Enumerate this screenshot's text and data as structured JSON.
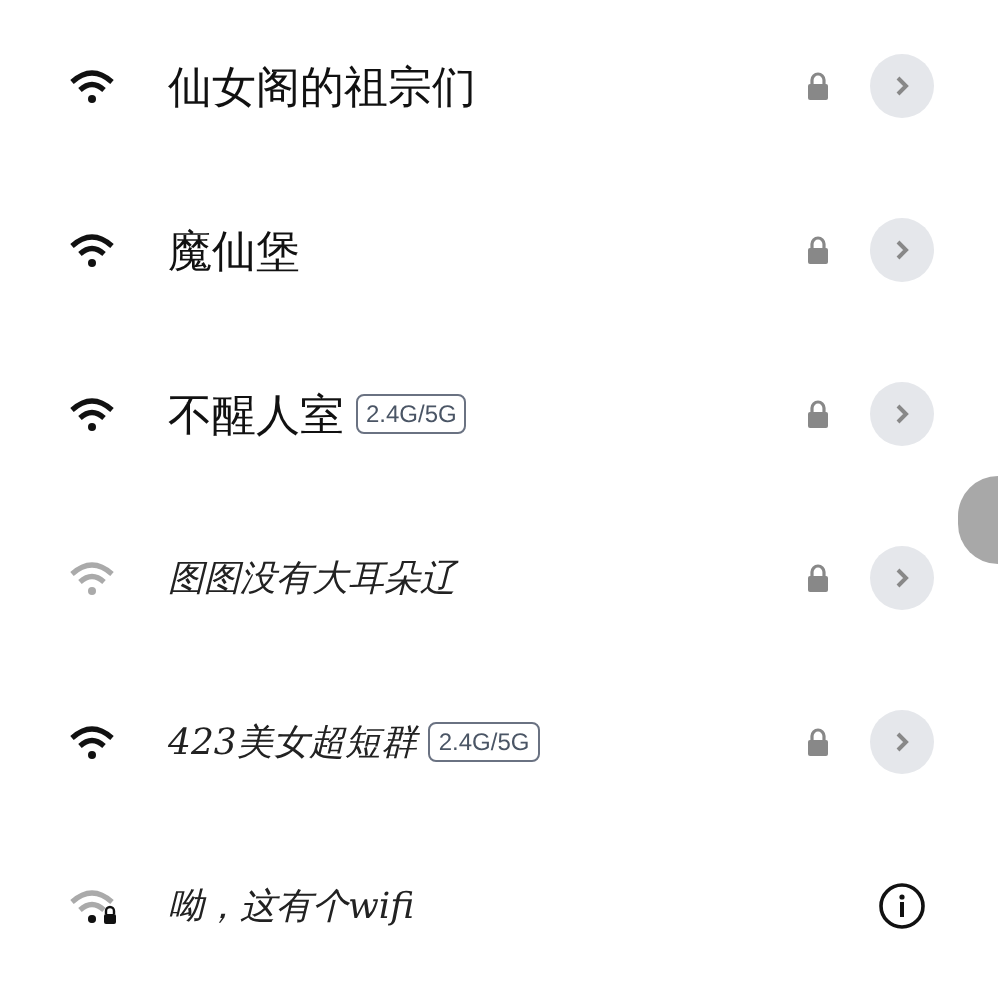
{
  "networks": [
    {
      "name": "仙女阁的祖宗们",
      "kind": "locked"
    },
    {
      "name": "魔仙堡",
      "kind": "locked"
    },
    {
      "name": "不醒人室",
      "kind": "locked",
      "band": "2.4G/5G"
    },
    {
      "name": "图图没有大耳朵辽",
      "kind": "locked"
    },
    {
      "name": "423美女超短群",
      "kind": "locked",
      "band": "2.4G/5G"
    },
    {
      "name": "呦，这有个wifi",
      "kind": "info"
    }
  ]
}
